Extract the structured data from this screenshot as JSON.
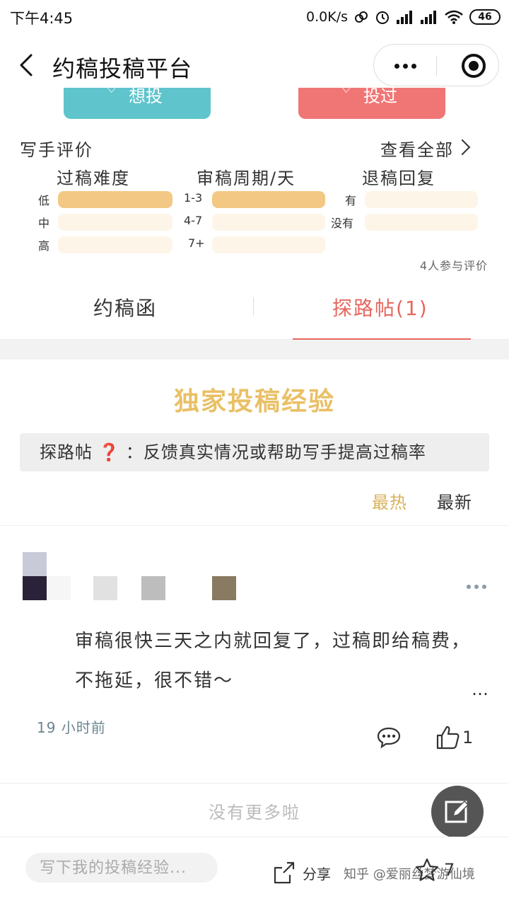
{
  "status_bar": {
    "time": "下午4:45",
    "network_speed": "0.0K/s",
    "battery": "46"
  },
  "nav": {
    "title": "约稿投稿平台"
  },
  "actions": {
    "want_label": "想投",
    "done_label": "投过"
  },
  "ratings": {
    "title": "写手评价",
    "view_all": "查看全部",
    "participants": "4人参与评价",
    "columns": [
      {
        "title": "过稿难度",
        "rows": [
          {
            "label": "低",
            "fraction": 1.0
          },
          {
            "label": "中",
            "fraction": 0.0
          },
          {
            "label": "高",
            "fraction": 0.0
          }
        ]
      },
      {
        "title": "审稿周期/天",
        "rows": [
          {
            "label": "1-3",
            "fraction": 1.0
          },
          {
            "label": "4-7",
            "fraction": 0.0
          },
          {
            "label": "7+",
            "fraction": 0.0
          }
        ]
      },
      {
        "title": "退稿回复",
        "rows": [
          {
            "label": "有",
            "fraction": 0.0
          },
          {
            "label": "没有",
            "fraction": 0.0
          }
        ]
      }
    ]
  },
  "tabs": {
    "invite": "约稿函",
    "explore": "探路帖(1)",
    "active": "explore"
  },
  "section": {
    "heading": "独家投稿经验",
    "info_prefix": "探路帖",
    "info_icon": "❓",
    "info_text": "：反馈真实情况或帮助写手提高过稿率",
    "sort_hot": "最热",
    "sort_new": "最新",
    "sort_active": "hot"
  },
  "post": {
    "content": "审稿很快三天之内就回复了，过稿即给稿费，不拖延，很不错～",
    "ellipsis": "…",
    "time": "19 小时前",
    "like_count": "1"
  },
  "footer": {
    "no_more": "没有更多啦",
    "input_placeholder": "写下我的投稿经验...",
    "share": "分享",
    "favorite_count": "7",
    "watermark": "知乎 @爱丽丝梦游仙境"
  },
  "colors": {
    "accent_red": "#e5685e",
    "gold": "#e9c066",
    "bar_fill": "#f2c884",
    "bar_empty": "#fdf5e8",
    "want_button": "#5fc4cc",
    "done_button": "#f07676"
  }
}
